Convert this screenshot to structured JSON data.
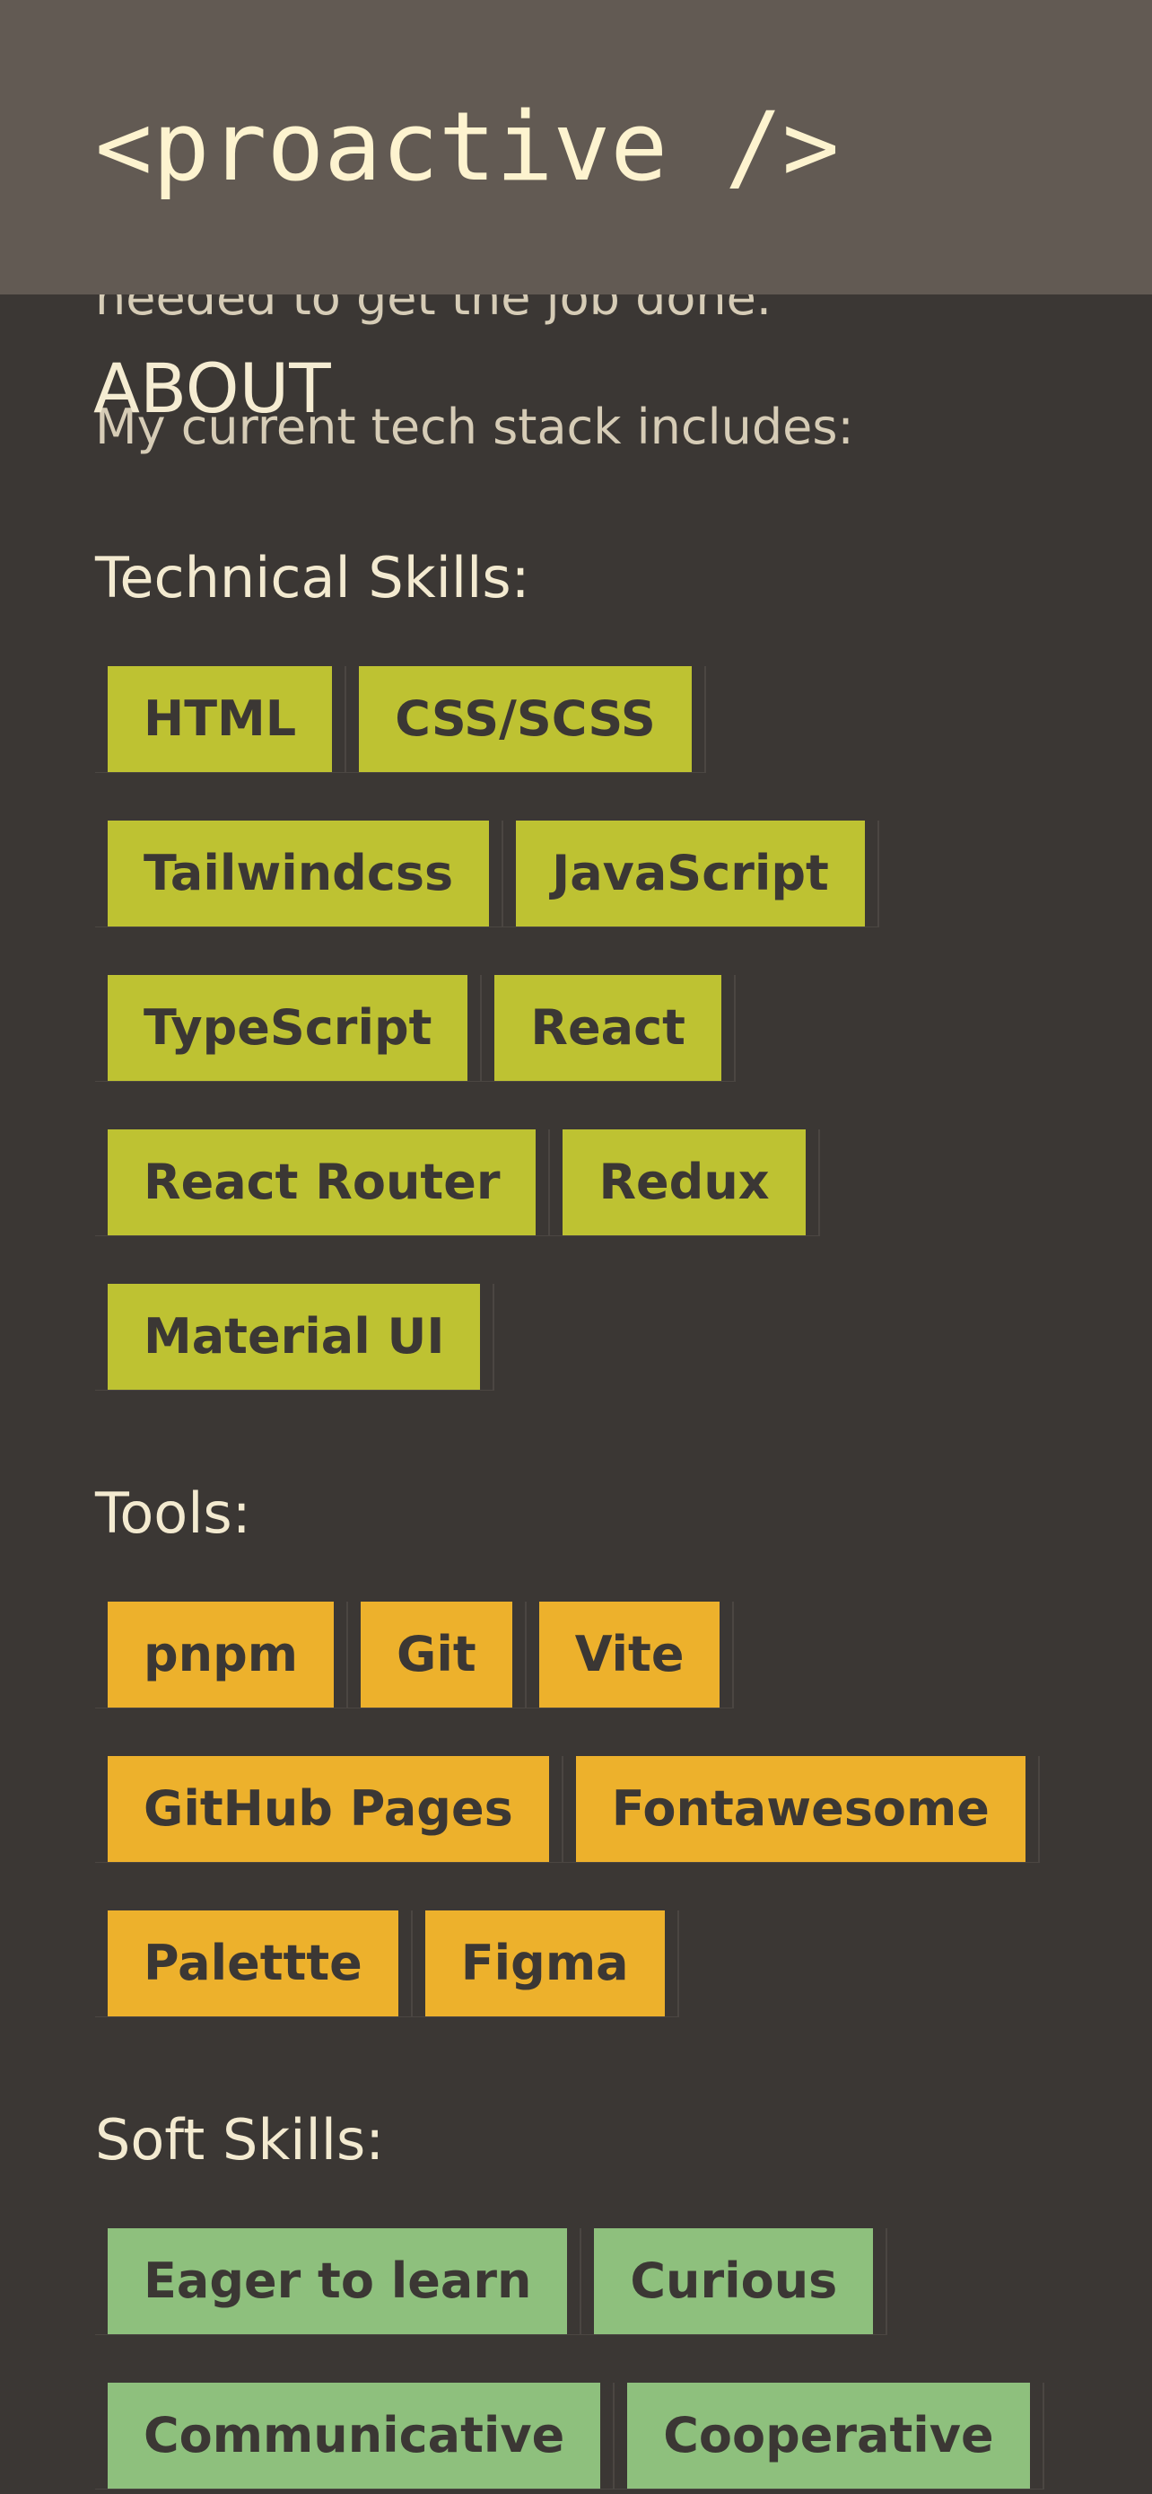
{
  "header": {
    "logo": "<proactive />"
  },
  "about": {
    "heading": "ABOUT",
    "intro_tail": "needed to get the job done.",
    "stack_intro": "My current tech stack includes:"
  },
  "technical": {
    "title": "Technical Skills:",
    "rows": [
      [
        "HTML",
        "CSS/SCSS"
      ],
      [
        "Tailwindcss",
        "JavaScript"
      ],
      [
        "TypeScript",
        "React"
      ],
      [
        "React Router",
        "Redux"
      ],
      [
        "Material UI"
      ]
    ]
  },
  "tools": {
    "title": "Tools:",
    "rows": [
      [
        "pnpm",
        "Git",
        "Vite"
      ],
      [
        "GitHub Pages",
        "Fontawesome"
      ],
      [
        "Palettte",
        "Figma"
      ]
    ]
  },
  "soft": {
    "title": "Soft Skills:",
    "rows": [
      [
        "Eager to learn",
        "Curious"
      ],
      [
        "Communicative",
        "Cooperative"
      ]
    ]
  },
  "colors": {
    "background": "#3b3734",
    "header_bar": "#625a53",
    "technical_tag": "#bec232",
    "tools_tag": "#edb12c",
    "soft_tag": "#8ec07d",
    "text": "#f5ecd2"
  }
}
